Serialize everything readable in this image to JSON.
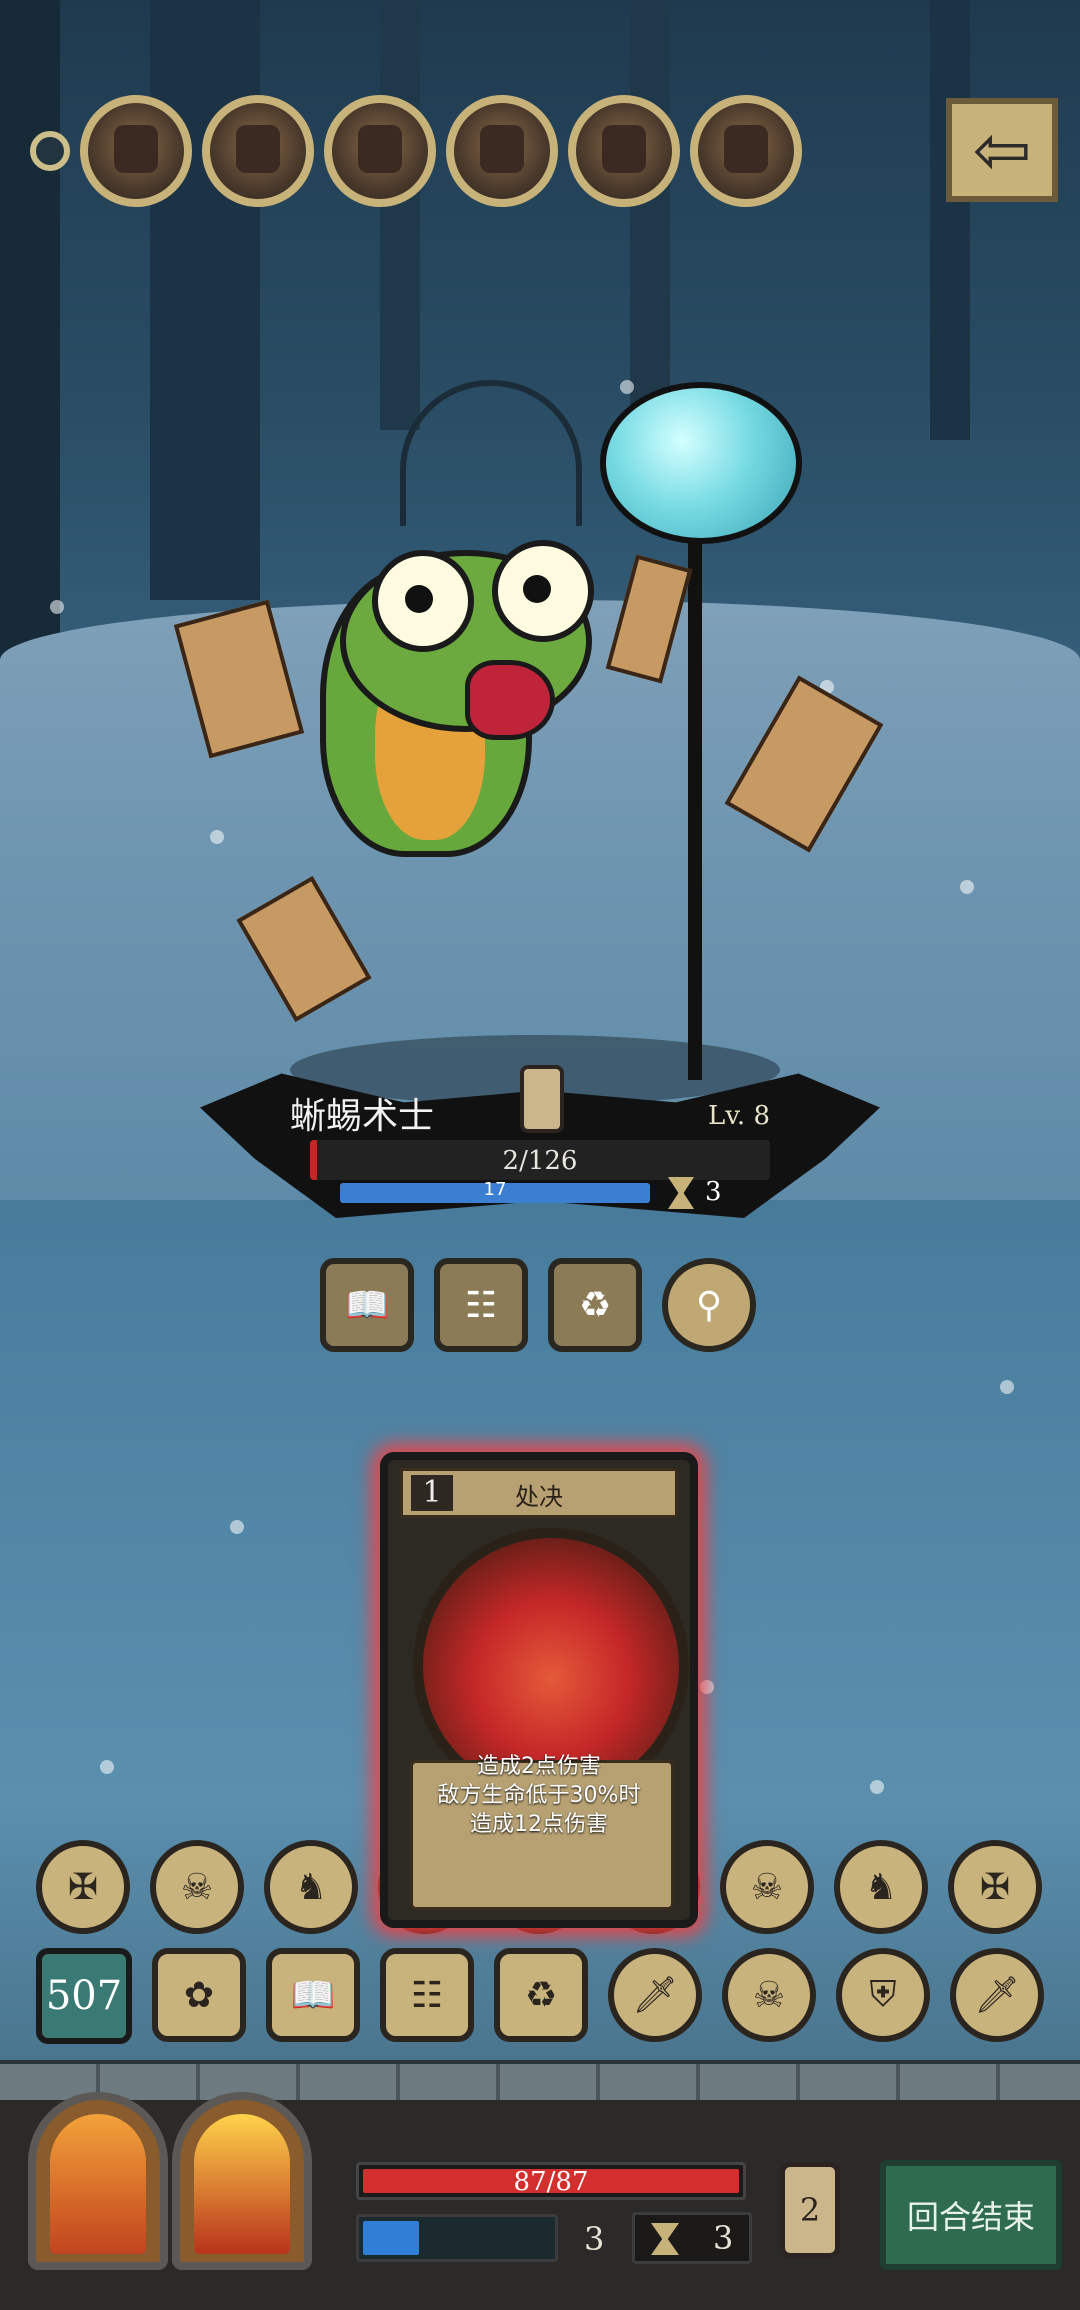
{
  "enemy_queue": {
    "portraits": [
      "enemy-portrait-icon",
      "enemy-portrait-icon",
      "enemy-portrait-icon",
      "enemy-portrait-icon",
      "dwarf-portrait-icon",
      "enemy-portrait-icon"
    ]
  },
  "top_bar": {
    "back_icon": "arrow-left-icon"
  },
  "enemy": {
    "name": "蜥蜴术士",
    "level": "Lv. 8",
    "hp_text": "2/126",
    "hp_fraction": 0.016,
    "shield_value": "17",
    "timer": "3",
    "intents": [
      "spellbook-icon",
      "cage-icon",
      "barrel-icon",
      "staff-icon"
    ]
  },
  "selected_card": {
    "cost": "1",
    "title": "处决",
    "description_lines": [
      "造成2点伤害",
      "敌方生命低于30%时",
      "造成12点伤害"
    ]
  },
  "hand_row_top": [
    "crossbow-icon",
    "skull-banner-icon",
    "horse-icon",
    "knife-icon",
    "skull-icon",
    "knife-icon",
    "skull-icon",
    "knight-icon",
    "crossbow-dark-icon"
  ],
  "hand_row_bottom": {
    "deck_count": "507",
    "items": [
      "phoenix-feather-icon",
      "spellbook-icon",
      "cage-icon",
      "barrel-icon",
      "knife-icon",
      "skull-icon",
      "armor-icon",
      "dagger-icon"
    ]
  },
  "player": {
    "hp_text": "87/87",
    "hp_fraction": 1.0,
    "shield_value": "3",
    "timer": "3",
    "energy": "2",
    "end_turn_label": "回合结束",
    "heroes": [
      "sword-hero-icon",
      "hooded-hero-icon"
    ]
  },
  "colors": {
    "highlight": "#ff3c3c",
    "hp": "#d32f2f",
    "shield": "#2f7fd6",
    "end_turn": "#2f6b4f"
  }
}
